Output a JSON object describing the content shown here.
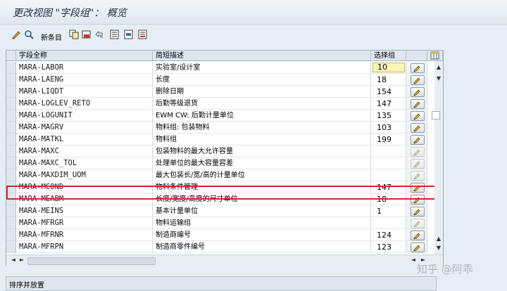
{
  "window": {
    "title": "更改视图 \"字段组\"： 概览"
  },
  "toolbar": {
    "new_entries_label": "新条目",
    "icons": [
      "change-display-icon",
      "search-icon",
      "copy-icon",
      "delete-icon",
      "undo-icon",
      "select-all-icon",
      "select-block-icon",
      "deselect-all-icon"
    ]
  },
  "table": {
    "columns": {
      "name": "字段全称",
      "desc": "简短描述",
      "group": "选择组"
    },
    "rows": [
      {
        "name": "MARA-LABOR",
        "desc": "实验室/设计室",
        "group": "10"
      },
      {
        "name": "MARA-LAENG",
        "desc": "长度",
        "group": "18"
      },
      {
        "name": "MARA-LIQDT",
        "desc": "删除日期",
        "group": "154"
      },
      {
        "name": "MARA-LOGLEV_RETO",
        "desc": "后勤等级退货",
        "group": "147"
      },
      {
        "name": "MARA-LOGUNIT",
        "desc": "EWM CW: 后勤计量单位",
        "group": "135"
      },
      {
        "name": "MARA-MAGRV",
        "desc": "物料组: 包装物料",
        "group": "103"
      },
      {
        "name": "MARA-MATKL",
        "desc": "物料组",
        "group": "199"
      },
      {
        "name": "MARA-MAXC",
        "desc": "包装物料的最大允许容量",
        "group": ""
      },
      {
        "name": "MARA-MAXC_TOL",
        "desc": "处理单位的最大容量容差",
        "group": ""
      },
      {
        "name": "MARA-MAXDIM_UOM",
        "desc": "最大包装长/宽/高的计量单位",
        "group": ""
      },
      {
        "name": "MARA-MCOND",
        "desc": "物料条件管理",
        "group": "147"
      },
      {
        "name": "MARA-MEABM",
        "desc": "长度/宽度/高度的尺寸单位",
        "group": "18"
      },
      {
        "name": "MARA-MEINS",
        "desc": "基本计量单位",
        "group": "1"
      },
      {
        "name": "MARA-MFRGR",
        "desc": "物料运输组",
        "group": ""
      },
      {
        "name": "MARA-MFRNR",
        "desc": "制造商编号",
        "group": "124"
      },
      {
        "name": "MARA-MFRPN",
        "desc": "制造商零件编号",
        "group": "123"
      }
    ],
    "highlighted_row": "MARA-MATKL",
    "active_cell_value": "10"
  },
  "section": {
    "label": "排序并放置"
  },
  "watermark": {
    "text": "知乎 @阿乖"
  },
  "colors": {
    "highlight_border": "#d9262a",
    "active_input": "#fff4b8",
    "header_bg": "#dfe6ee"
  }
}
